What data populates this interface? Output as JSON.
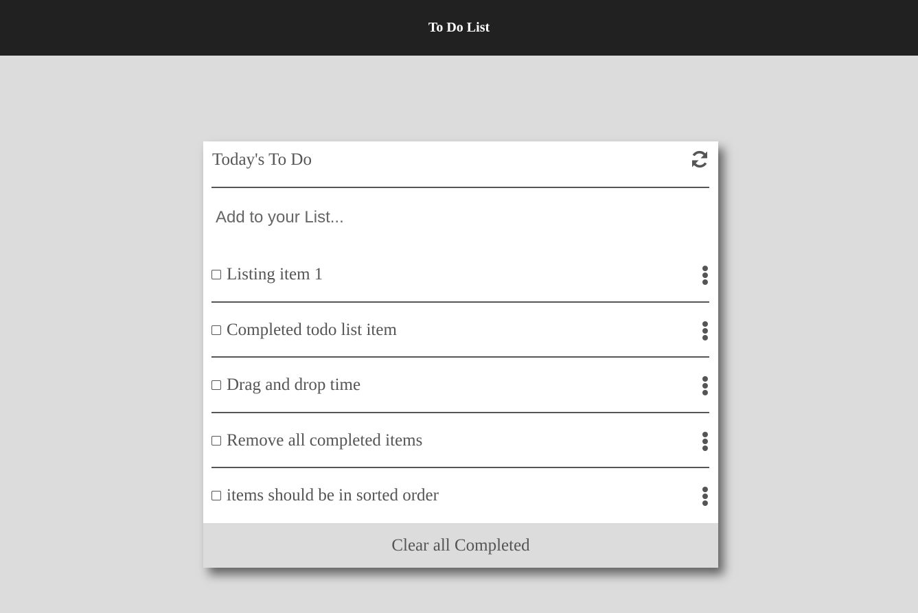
{
  "app": {
    "title": "To Do List"
  },
  "card": {
    "title": "Today's To Do",
    "refresh_icon": "refresh-icon",
    "input": {
      "placeholder": "Add to your List...",
      "value": ""
    },
    "items": [
      {
        "label": "Listing item 1",
        "checked": false,
        "menu_icon": "kebab-menu-icon"
      },
      {
        "label": "Completed todo list item",
        "checked": false,
        "menu_icon": "kebab-menu-icon"
      },
      {
        "label": "Drag and drop time",
        "checked": false,
        "menu_icon": "kebab-menu-icon"
      },
      {
        "label": "Remove all completed items",
        "checked": false,
        "menu_icon": "kebab-menu-icon"
      },
      {
        "label": "items should be in sorted order",
        "checked": false,
        "menu_icon": "kebab-menu-icon"
      }
    ],
    "clear_label": "Clear all Completed"
  },
  "colors": {
    "topbar": "#212121",
    "background": "#dcdcdc",
    "text": "#555555",
    "card": "#ffffff"
  }
}
